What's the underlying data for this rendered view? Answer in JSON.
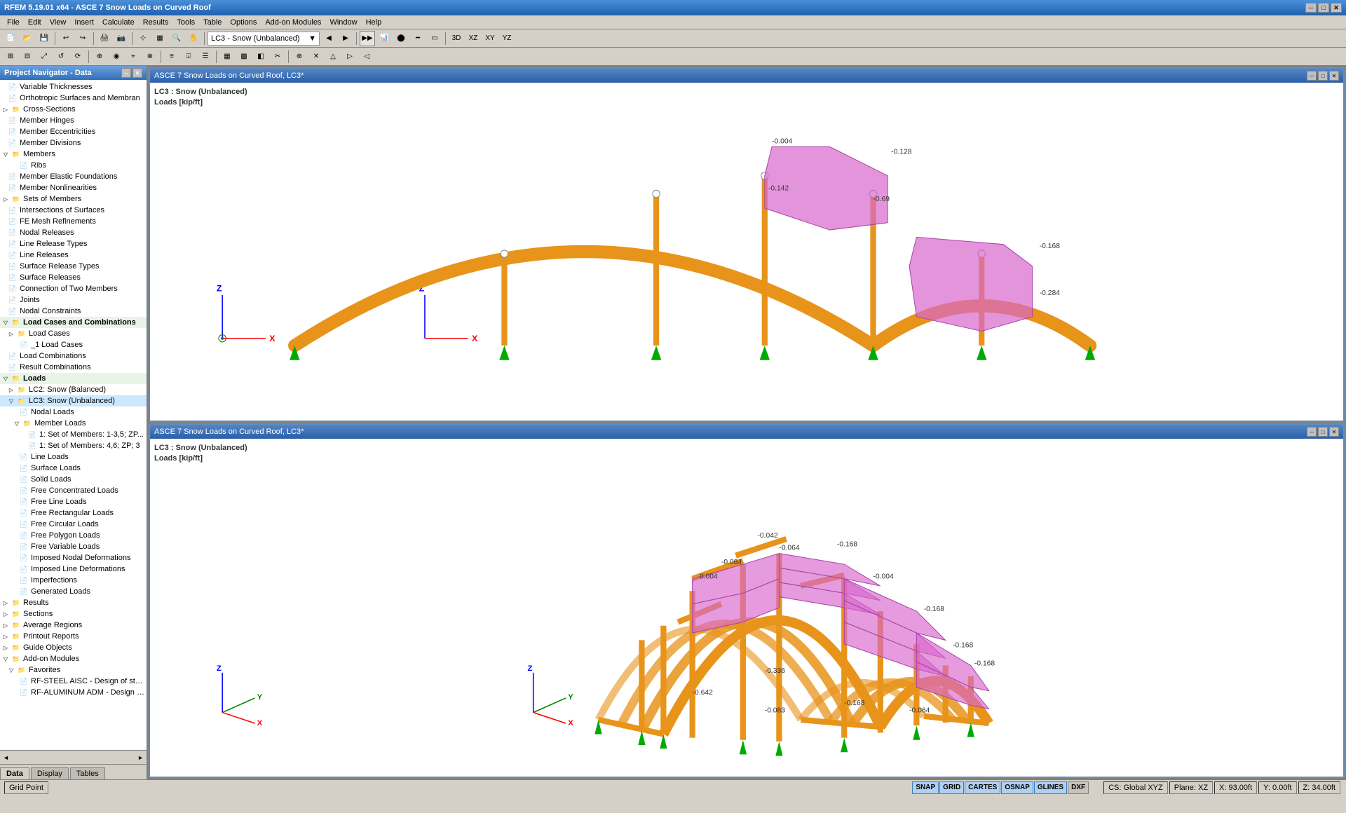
{
  "titleBar": {
    "title": "RFEM 5.19.01 x64 - ASCE 7 Snow Loads on Curved Roof",
    "minimize": "─",
    "maximize": "□",
    "close": "✕"
  },
  "menuBar": {
    "items": [
      "File",
      "Edit",
      "View",
      "Insert",
      "Calculate",
      "Results",
      "Tools",
      "Table",
      "Options",
      "Add-on Modules",
      "Window",
      "Help"
    ]
  },
  "loadCaseDropdown": "LC3 - Snow (Unbalanced)",
  "leftPanel": {
    "title": "Project Navigator - Data",
    "tabs": [
      "Data",
      "Display",
      "Tables"
    ],
    "tree": [
      {
        "id": 1,
        "level": 1,
        "label": "Variable Thicknesses",
        "type": "doc",
        "expand": "none"
      },
      {
        "id": 2,
        "level": 1,
        "label": "Orthotropic Surfaces and Membran",
        "type": "doc",
        "expand": "none"
      },
      {
        "id": 3,
        "level": 1,
        "label": "Cross-Sections",
        "type": "folder",
        "expand": "collapsed"
      },
      {
        "id": 4,
        "level": 1,
        "label": "Member Hinges",
        "type": "doc",
        "expand": "none"
      },
      {
        "id": 5,
        "level": 1,
        "label": "Member Eccentricities",
        "type": "doc",
        "expand": "none"
      },
      {
        "id": 6,
        "level": 1,
        "label": "Member Divisions",
        "type": "doc",
        "expand": "none"
      },
      {
        "id": 7,
        "level": 1,
        "label": "Members",
        "type": "folder",
        "expand": "collapsed"
      },
      {
        "id": 8,
        "level": 2,
        "label": "Ribs",
        "type": "doc",
        "expand": "none"
      },
      {
        "id": 9,
        "level": 1,
        "label": "Member Elastic Foundations",
        "type": "doc",
        "expand": "none"
      },
      {
        "id": 10,
        "level": 1,
        "label": "Member Nonlinearities",
        "type": "doc",
        "expand": "none"
      },
      {
        "id": 11,
        "level": 1,
        "label": "Sets of Members",
        "type": "folder",
        "expand": "collapsed"
      },
      {
        "id": 12,
        "level": 1,
        "label": "Intersections of Surfaces",
        "type": "doc",
        "expand": "none"
      },
      {
        "id": 13,
        "level": 1,
        "label": "FE Mesh Refinements",
        "type": "doc",
        "expand": "none"
      },
      {
        "id": 14,
        "level": 1,
        "label": "Nodal Releases",
        "type": "doc",
        "expand": "none"
      },
      {
        "id": 15,
        "level": 1,
        "label": "Line Release Types",
        "type": "doc",
        "expand": "none"
      },
      {
        "id": 16,
        "level": 1,
        "label": "Line Releases",
        "type": "doc",
        "expand": "none"
      },
      {
        "id": 17,
        "level": 1,
        "label": "Surface Release Types",
        "type": "doc",
        "expand": "none"
      },
      {
        "id": 18,
        "level": 1,
        "label": "Surface Releases",
        "type": "doc",
        "expand": "none"
      },
      {
        "id": 19,
        "level": 1,
        "label": "Connection of Two Members",
        "type": "doc",
        "expand": "none"
      },
      {
        "id": 20,
        "level": 1,
        "label": "Joints",
        "type": "doc",
        "expand": "none"
      },
      {
        "id": 21,
        "level": 1,
        "label": "Nodal Constraints",
        "type": "doc",
        "expand": "none"
      },
      {
        "id": 22,
        "level": 0,
        "label": "Load Cases and Combinations",
        "type": "folder",
        "expand": "expanded"
      },
      {
        "id": 23,
        "level": 1,
        "label": "Load Cases",
        "type": "folder",
        "expand": "collapsed"
      },
      {
        "id": 24,
        "level": 2,
        "label": "Load Cases",
        "type": "doc",
        "expand": "none"
      },
      {
        "id": 25,
        "level": 1,
        "label": "Load Combinations",
        "type": "doc",
        "expand": "none"
      },
      {
        "id": 26,
        "level": 1,
        "label": "Result Combinations",
        "type": "doc",
        "expand": "none"
      },
      {
        "id": 27,
        "level": 0,
        "label": "Loads",
        "type": "folder",
        "expand": "expanded"
      },
      {
        "id": 28,
        "level": 1,
        "label": "LC2: Snow (Balanced)",
        "type": "folder",
        "expand": "collapsed"
      },
      {
        "id": 29,
        "level": 1,
        "label": "LC3: Snow (Unbalanced)",
        "type": "folder",
        "expand": "expanded"
      },
      {
        "id": 30,
        "level": 2,
        "label": "Nodal Loads",
        "type": "doc",
        "expand": "none"
      },
      {
        "id": 31,
        "level": 2,
        "label": "Member Loads",
        "type": "folder",
        "expand": "expanded"
      },
      {
        "id": 32,
        "level": 3,
        "label": "1: Set of Members: 1-3,5; ZP...",
        "type": "doc",
        "expand": "none"
      },
      {
        "id": 33,
        "level": 3,
        "label": "1: Set of Members: 4,6; ZP; 3",
        "type": "doc",
        "expand": "none"
      },
      {
        "id": 34,
        "level": 2,
        "label": "Line Loads",
        "type": "doc",
        "expand": "none"
      },
      {
        "id": 35,
        "level": 2,
        "label": "Surface Loads",
        "type": "doc",
        "expand": "none"
      },
      {
        "id": 36,
        "level": 2,
        "label": "Solid Loads",
        "type": "doc",
        "expand": "none"
      },
      {
        "id": 37,
        "level": 2,
        "label": "Free Concentrated Loads",
        "type": "doc",
        "expand": "none"
      },
      {
        "id": 38,
        "level": 2,
        "label": "Free Line Loads",
        "type": "doc",
        "expand": "none"
      },
      {
        "id": 39,
        "level": 2,
        "label": "Free Rectangular Loads",
        "type": "doc",
        "expand": "none"
      },
      {
        "id": 40,
        "level": 2,
        "label": "Free Circular Loads",
        "type": "doc",
        "expand": "none"
      },
      {
        "id": 41,
        "level": 2,
        "label": "Free Polygon Loads",
        "type": "doc",
        "expand": "none"
      },
      {
        "id": 42,
        "level": 2,
        "label": "Free Variable Loads",
        "type": "doc",
        "expand": "none"
      },
      {
        "id": 43,
        "level": 2,
        "label": "Imposed Nodal Deformations",
        "type": "doc",
        "expand": "none"
      },
      {
        "id": 44,
        "level": 2,
        "label": "Imposed Line Deformations",
        "type": "doc",
        "expand": "none"
      },
      {
        "id": 45,
        "level": 2,
        "label": "Imperfections",
        "type": "doc",
        "expand": "none"
      },
      {
        "id": 46,
        "level": 2,
        "label": "Generated Loads",
        "type": "doc",
        "expand": "none"
      },
      {
        "id": 47,
        "level": 0,
        "label": "Results",
        "type": "folder",
        "expand": "collapsed"
      },
      {
        "id": 48,
        "level": 0,
        "label": "Sections",
        "type": "folder",
        "expand": "collapsed"
      },
      {
        "id": 49,
        "level": 0,
        "label": "Average Regions",
        "type": "folder",
        "expand": "collapsed"
      },
      {
        "id": 50,
        "level": 0,
        "label": "Printout Reports",
        "type": "folder",
        "expand": "collapsed"
      },
      {
        "id": 51,
        "level": 0,
        "label": "Guide Objects",
        "type": "folder",
        "expand": "collapsed"
      },
      {
        "id": 52,
        "level": 0,
        "label": "Add-on Modules",
        "type": "folder",
        "expand": "expanded"
      },
      {
        "id": 53,
        "level": 1,
        "label": "Favorites",
        "type": "folder",
        "expand": "expanded"
      },
      {
        "id": 54,
        "level": 2,
        "label": "RF-STEEL AISC - Design of steel",
        "type": "doc",
        "expand": "none"
      },
      {
        "id": 55,
        "level": 2,
        "label": "RF-ALUMINUM ADM - Design c v",
        "type": "doc",
        "expand": "none"
      }
    ]
  },
  "viewport1": {
    "title": "ASCE 7 Snow Loads on Curved Roof, LC3*",
    "loadCase": "LC3 : Snow (Unbalanced)",
    "units": "Loads [kip/ft]"
  },
  "viewport2": {
    "title": "ASCE 7 Snow Loads on Curved Roof, LC3*",
    "loadCase": "LC3 : Snow (Unbalanced)",
    "units": "Loads [kip/ft]"
  },
  "statusBar": {
    "gridPoint": "Grid Point",
    "snapButtons": [
      "SNAP",
      "GRID",
      "CARTES",
      "OSNAP",
      "GLINES",
      "DXF"
    ],
    "activeSnaps": [
      "SNAP",
      "GRID",
      "CARTES",
      "OSNAP",
      "GLINES"
    ],
    "cs": "CS: Global XYZ",
    "plane": "Plane: XZ",
    "x": "X: 93.00ft",
    "y": "Y: 0.00ft",
    "z": "Z: 34.00ft"
  }
}
